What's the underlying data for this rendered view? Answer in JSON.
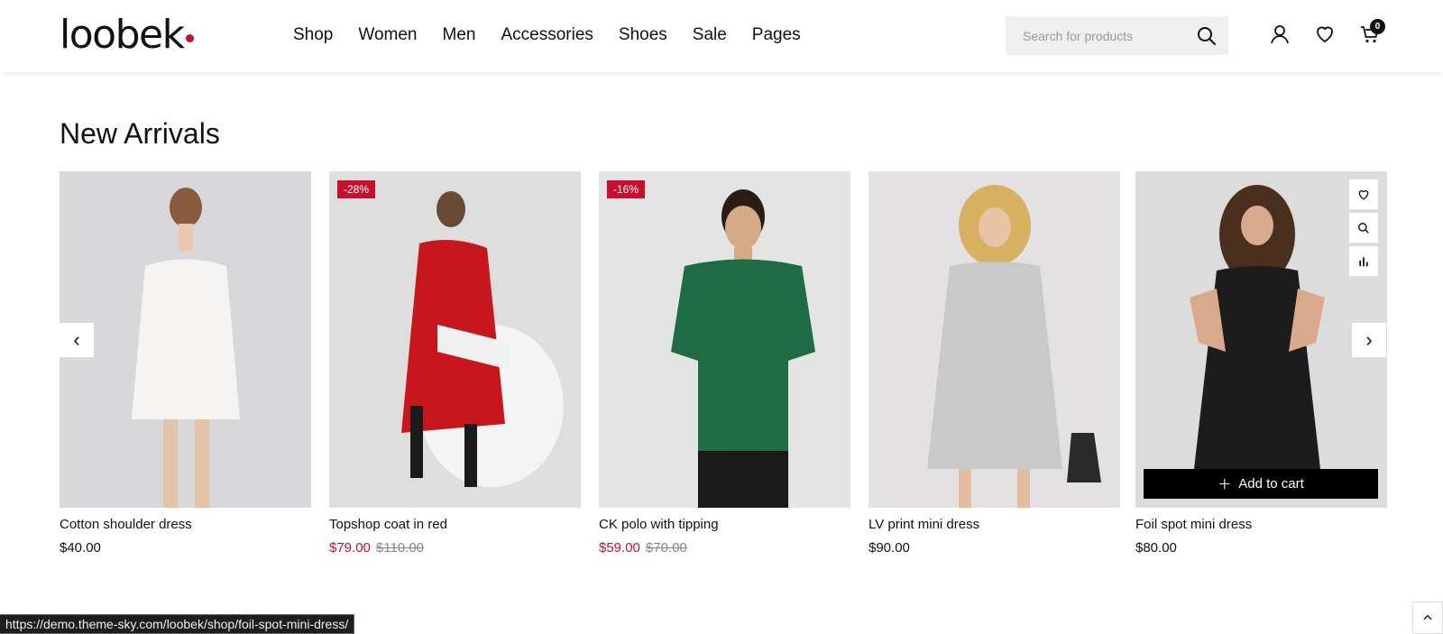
{
  "header": {
    "logo": "loobek",
    "nav": [
      "Shop",
      "Women",
      "Men",
      "Accessories",
      "Shoes",
      "Sale",
      "Pages"
    ],
    "search_placeholder": "Search for products",
    "cart_count": "0",
    "icons": [
      "search-icon",
      "user-icon",
      "heart-icon",
      "cart-icon"
    ]
  },
  "section": {
    "title": "New Arrivals"
  },
  "products": [
    {
      "name": "Cotton shoulder dress",
      "price": "$40.00",
      "old_price": "",
      "badge": ""
    },
    {
      "name": "Topshop coat in red",
      "price": "$79.00",
      "old_price": "$110.00",
      "badge": "-28%"
    },
    {
      "name": "CK polo with tipping",
      "price": "$59.00",
      "old_price": "$70.00",
      "badge": "-16%"
    },
    {
      "name": "LV print mini dress",
      "price": "$90.00",
      "old_price": "",
      "badge": ""
    },
    {
      "name": "Foil spot mini dress",
      "price": "$80.00",
      "old_price": "",
      "badge": ""
    }
  ],
  "hover_card": {
    "add_to_cart": "Add to cart"
  },
  "carousel": {
    "prev": "‹",
    "next": "›"
  },
  "status_bar": {
    "url": "https://demo.theme-sky.com/loobek/shop/foil-spot-mini-dress/"
  },
  "colors": {
    "accent": "#c8102e",
    "dark": "#000000"
  }
}
